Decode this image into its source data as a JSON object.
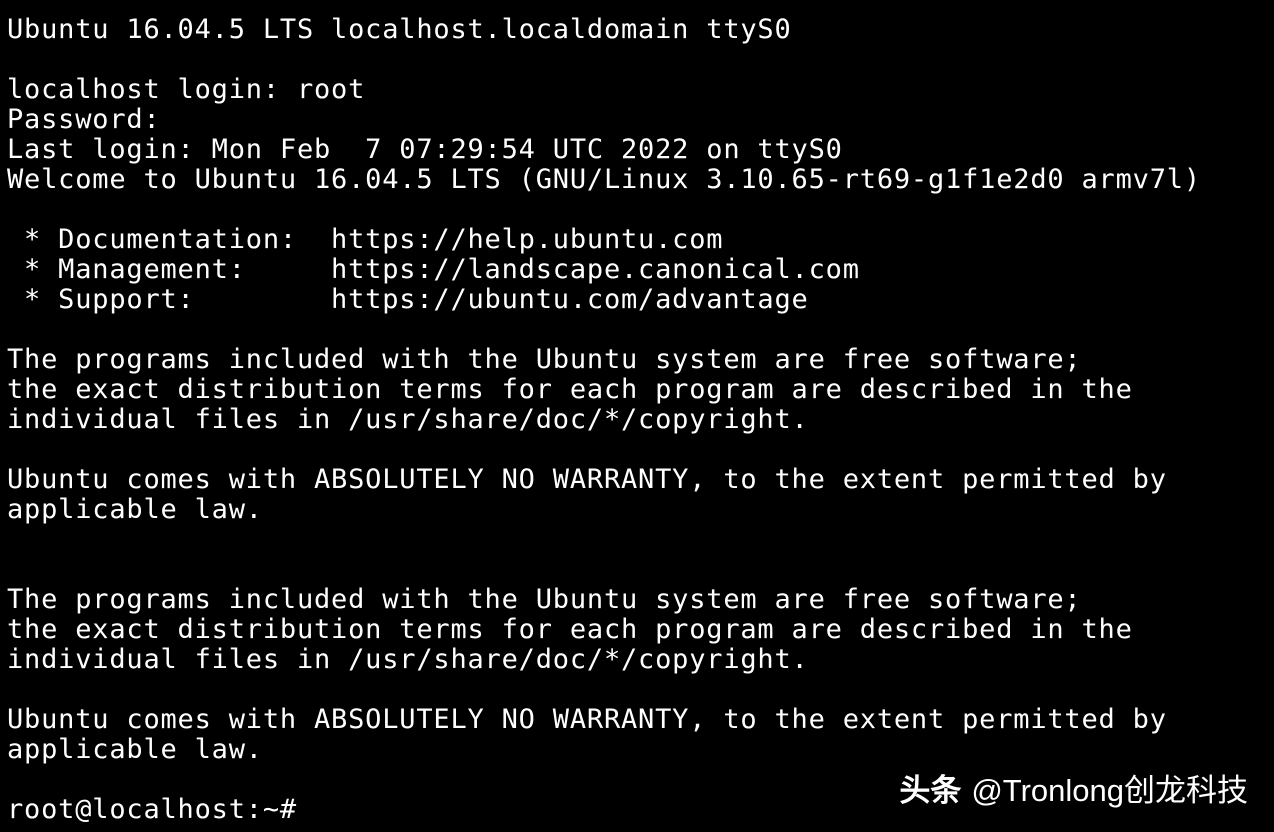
{
  "terminal": {
    "lines": [
      "Ubuntu 16.04.5 LTS localhost.localdomain ttyS0",
      "",
      "localhost login: root",
      "Password:",
      "Last login: Mon Feb  7 07:29:54 UTC 2022 on ttyS0",
      "Welcome to Ubuntu 16.04.5 LTS (GNU/Linux 3.10.65-rt69-g1f1e2d0 armv7l)",
      "",
      " * Documentation:  https://help.ubuntu.com",
      " * Management:     https://landscape.canonical.com",
      " * Support:        https://ubuntu.com/advantage",
      "",
      "The programs included with the Ubuntu system are free software;",
      "the exact distribution terms for each program are described in the",
      "individual files in /usr/share/doc/*/copyright.",
      "",
      "Ubuntu comes with ABSOLUTELY NO WARRANTY, to the extent permitted by",
      "applicable law.",
      "",
      "",
      "The programs included with the Ubuntu system are free software;",
      "the exact distribution terms for each program are described in the",
      "individual files in /usr/share/doc/*/copyright.",
      "",
      "Ubuntu comes with ABSOLUTELY NO WARRANTY, to the extent permitted by",
      "applicable law.",
      "",
      "root@localhost:~#"
    ]
  },
  "watermark": {
    "brand": "头条",
    "handle": "@Tronlong创龙科技"
  },
  "colors": {
    "background": "#000000",
    "text": "#ffffff"
  }
}
